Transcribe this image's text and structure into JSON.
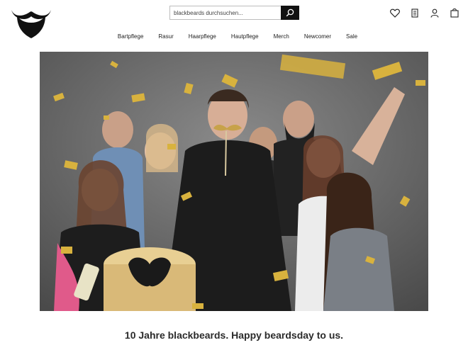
{
  "header": {
    "logo_icon": "beard-mustache-logo",
    "search": {
      "placeholder": "blackbeards durchsuchen...",
      "button_icon": "search-icon"
    },
    "icons": [
      "heart-icon",
      "notepad-icon",
      "user-icon",
      "shopping-bag-icon"
    ]
  },
  "nav": {
    "items": [
      {
        "label": "Bartpflege"
      },
      {
        "label": "Rasur"
      },
      {
        "label": "Haarpflege"
      },
      {
        "label": "Hautpflege"
      },
      {
        "label": "Merch"
      },
      {
        "label": "Newcomer"
      },
      {
        "label": "Sale"
      }
    ]
  },
  "hero": {
    "image": "party-photo-group-with-confetti-and-beard-cake"
  },
  "tagline": "10 Jahre blackbeards. Happy beardsday to us.",
  "colors": {
    "brand": "#111111",
    "confetti": "#d8b23e",
    "background_photo": "#5a5a5a"
  }
}
